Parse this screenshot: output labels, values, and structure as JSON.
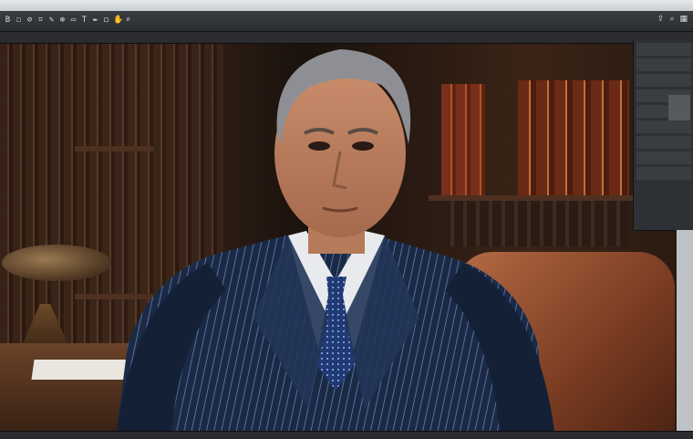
{
  "window": {
    "crumbs": [
      "",
      "",
      ""
    ],
    "document_title": ""
  },
  "toolbar": {
    "tools": [
      {
        "name": "move-tool-icon",
        "glyph": "B"
      },
      {
        "name": "select-tool-icon",
        "glyph": "☐"
      },
      {
        "name": "lasso-tool-icon",
        "glyph": "⊘"
      },
      {
        "name": "crop-tool-icon",
        "glyph": "⌗"
      },
      {
        "name": "brush-tool-icon",
        "glyph": "✎"
      },
      {
        "name": "stamp-tool-icon",
        "glyph": "⊕"
      },
      {
        "name": "eraser-tool-icon",
        "glyph": "▭"
      },
      {
        "name": "text-tool-icon",
        "glyph": "T"
      },
      {
        "name": "pen-tool-icon",
        "glyph": "✒"
      },
      {
        "name": "shape-tool-icon",
        "glyph": "◻"
      },
      {
        "name": "hand-tool-icon",
        "glyph": "✋"
      },
      {
        "name": "zoom-tool-icon",
        "glyph": "⌕"
      }
    ],
    "right": [
      {
        "name": "share-icon",
        "glyph": "⇪"
      },
      {
        "name": "search-icon",
        "glyph": "⌕"
      },
      {
        "name": "workspace-icon",
        "glyph": "▦"
      }
    ]
  },
  "panels": {
    "rows": [
      "",
      "",
      "",
      "",
      "",
      "",
      "",
      "",
      ""
    ]
  },
  "status": {
    "zoom": ""
  },
  "colors": {
    "chrome": "#2b2d30",
    "panel": "#2d3034",
    "robe": "#1c2a44",
    "chair": "#9a5233"
  }
}
